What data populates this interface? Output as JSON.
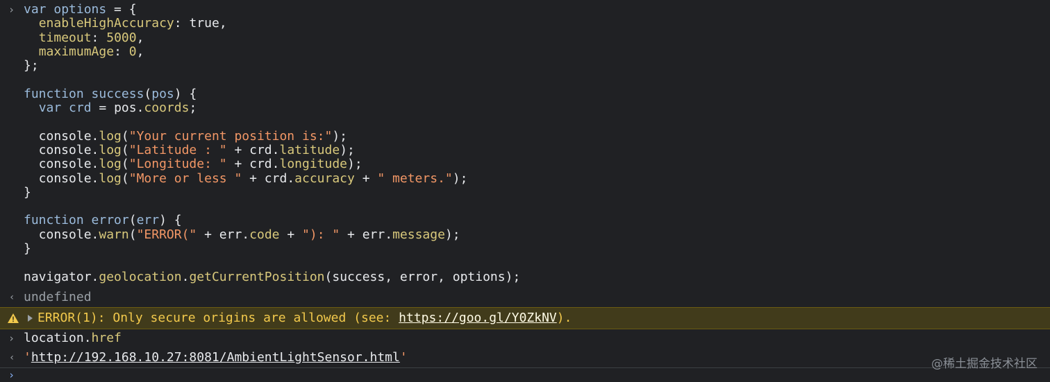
{
  "console": {
    "input_prompt": "›",
    "result_prompt": "‹",
    "code_lines": [
      [
        {
          "t": "kw",
          "v": "var "
        },
        {
          "t": "prop",
          "v": "options"
        },
        {
          "t": "txt",
          "v": " = {"
        }
      ],
      [
        {
          "t": "txt",
          "v": "  "
        },
        {
          "t": "method",
          "v": "enableHighAccuracy"
        },
        {
          "t": "txt",
          "v": ": "
        },
        {
          "t": "txt",
          "v": "true"
        },
        {
          "t": "txt",
          "v": ","
        }
      ],
      [
        {
          "t": "txt",
          "v": "  "
        },
        {
          "t": "method",
          "v": "timeout"
        },
        {
          "t": "txt",
          "v": ": "
        },
        {
          "t": "num",
          "v": "5000"
        },
        {
          "t": "txt",
          "v": ","
        }
      ],
      [
        {
          "t": "txt",
          "v": "  "
        },
        {
          "t": "method",
          "v": "maximumAge"
        },
        {
          "t": "txt",
          "v": ": "
        },
        {
          "t": "num",
          "v": "0"
        },
        {
          "t": "txt",
          "v": ","
        }
      ],
      [
        {
          "t": "txt",
          "v": "};"
        }
      ],
      [
        {
          "t": "txt",
          "v": ""
        }
      ],
      [
        {
          "t": "kw",
          "v": "function "
        },
        {
          "t": "prop",
          "v": "success"
        },
        {
          "t": "txt",
          "v": "("
        },
        {
          "t": "prop",
          "v": "pos"
        },
        {
          "t": "txt",
          "v": ") {"
        }
      ],
      [
        {
          "t": "txt",
          "v": "  "
        },
        {
          "t": "kw",
          "v": "var "
        },
        {
          "t": "prop",
          "v": "crd"
        },
        {
          "t": "txt",
          "v": " = pos."
        },
        {
          "t": "method",
          "v": "coords"
        },
        {
          "t": "txt",
          "v": ";"
        }
      ],
      [
        {
          "t": "txt",
          "v": ""
        }
      ],
      [
        {
          "t": "txt",
          "v": "  console."
        },
        {
          "t": "method",
          "v": "log"
        },
        {
          "t": "txt",
          "v": "("
        },
        {
          "t": "str",
          "v": "\"Your current position is:\""
        },
        {
          "t": "txt",
          "v": ");"
        }
      ],
      [
        {
          "t": "txt",
          "v": "  console."
        },
        {
          "t": "method",
          "v": "log"
        },
        {
          "t": "txt",
          "v": "("
        },
        {
          "t": "str",
          "v": "\"Latitude : \""
        },
        {
          "t": "txt",
          "v": " + crd."
        },
        {
          "t": "method",
          "v": "latitude"
        },
        {
          "t": "txt",
          "v": ");"
        }
      ],
      [
        {
          "t": "txt",
          "v": "  console."
        },
        {
          "t": "method",
          "v": "log"
        },
        {
          "t": "txt",
          "v": "("
        },
        {
          "t": "str",
          "v": "\"Longitude: \""
        },
        {
          "t": "txt",
          "v": " + crd."
        },
        {
          "t": "method",
          "v": "longitude"
        },
        {
          "t": "txt",
          "v": ");"
        }
      ],
      [
        {
          "t": "txt",
          "v": "  console."
        },
        {
          "t": "method",
          "v": "log"
        },
        {
          "t": "txt",
          "v": "("
        },
        {
          "t": "str",
          "v": "\"More or less \""
        },
        {
          "t": "txt",
          "v": " + crd."
        },
        {
          "t": "method",
          "v": "accuracy"
        },
        {
          "t": "txt",
          "v": " + "
        },
        {
          "t": "str",
          "v": "\" meters.\""
        },
        {
          "t": "txt",
          "v": ");"
        }
      ],
      [
        {
          "t": "txt",
          "v": "}"
        }
      ],
      [
        {
          "t": "txt",
          "v": ""
        }
      ],
      [
        {
          "t": "kw",
          "v": "function "
        },
        {
          "t": "prop",
          "v": "error"
        },
        {
          "t": "txt",
          "v": "("
        },
        {
          "t": "prop",
          "v": "err"
        },
        {
          "t": "txt",
          "v": ") {"
        }
      ],
      [
        {
          "t": "txt",
          "v": "  console."
        },
        {
          "t": "method",
          "v": "warn"
        },
        {
          "t": "txt",
          "v": "("
        },
        {
          "t": "str",
          "v": "\"ERROR(\""
        },
        {
          "t": "txt",
          "v": " + err."
        },
        {
          "t": "method",
          "v": "code"
        },
        {
          "t": "txt",
          "v": " + "
        },
        {
          "t": "str",
          "v": "\"): \""
        },
        {
          "t": "txt",
          "v": " + err."
        },
        {
          "t": "method",
          "v": "message"
        },
        {
          "t": "txt",
          "v": ");"
        }
      ],
      [
        {
          "t": "txt",
          "v": "}"
        }
      ],
      [
        {
          "t": "txt",
          "v": ""
        }
      ],
      [
        {
          "t": "txt",
          "v": "navigator."
        },
        {
          "t": "method",
          "v": "geolocation"
        },
        {
          "t": "txt",
          "v": "."
        },
        {
          "t": "method",
          "v": "getCurrentPosition"
        },
        {
          "t": "txt",
          "v": "(success, error, options);"
        }
      ]
    ],
    "undefined_result": "undefined",
    "warning": {
      "icon": "warning-triangle-icon",
      "prefix": "ERROR(1): Only secure origins are allowed (see: ",
      "link": "https://goo.gl/Y0ZkNV",
      "suffix": ")."
    },
    "href_input": {
      "obj": "location.",
      "prop": "href"
    },
    "href_result": {
      "quote_open": "'",
      "link": "http://192.168.10.27:8081/AmbientLightSensor.html",
      "quote_close": "'"
    },
    "watermark": "@稀土掘金技术社区"
  },
  "colors": {
    "background": "#202124",
    "keyword": "#9bbbdc",
    "string": "#f29766",
    "number": "#d9c97c",
    "warning_bg": "#413b1b",
    "warning_text": "#f2c94c"
  }
}
